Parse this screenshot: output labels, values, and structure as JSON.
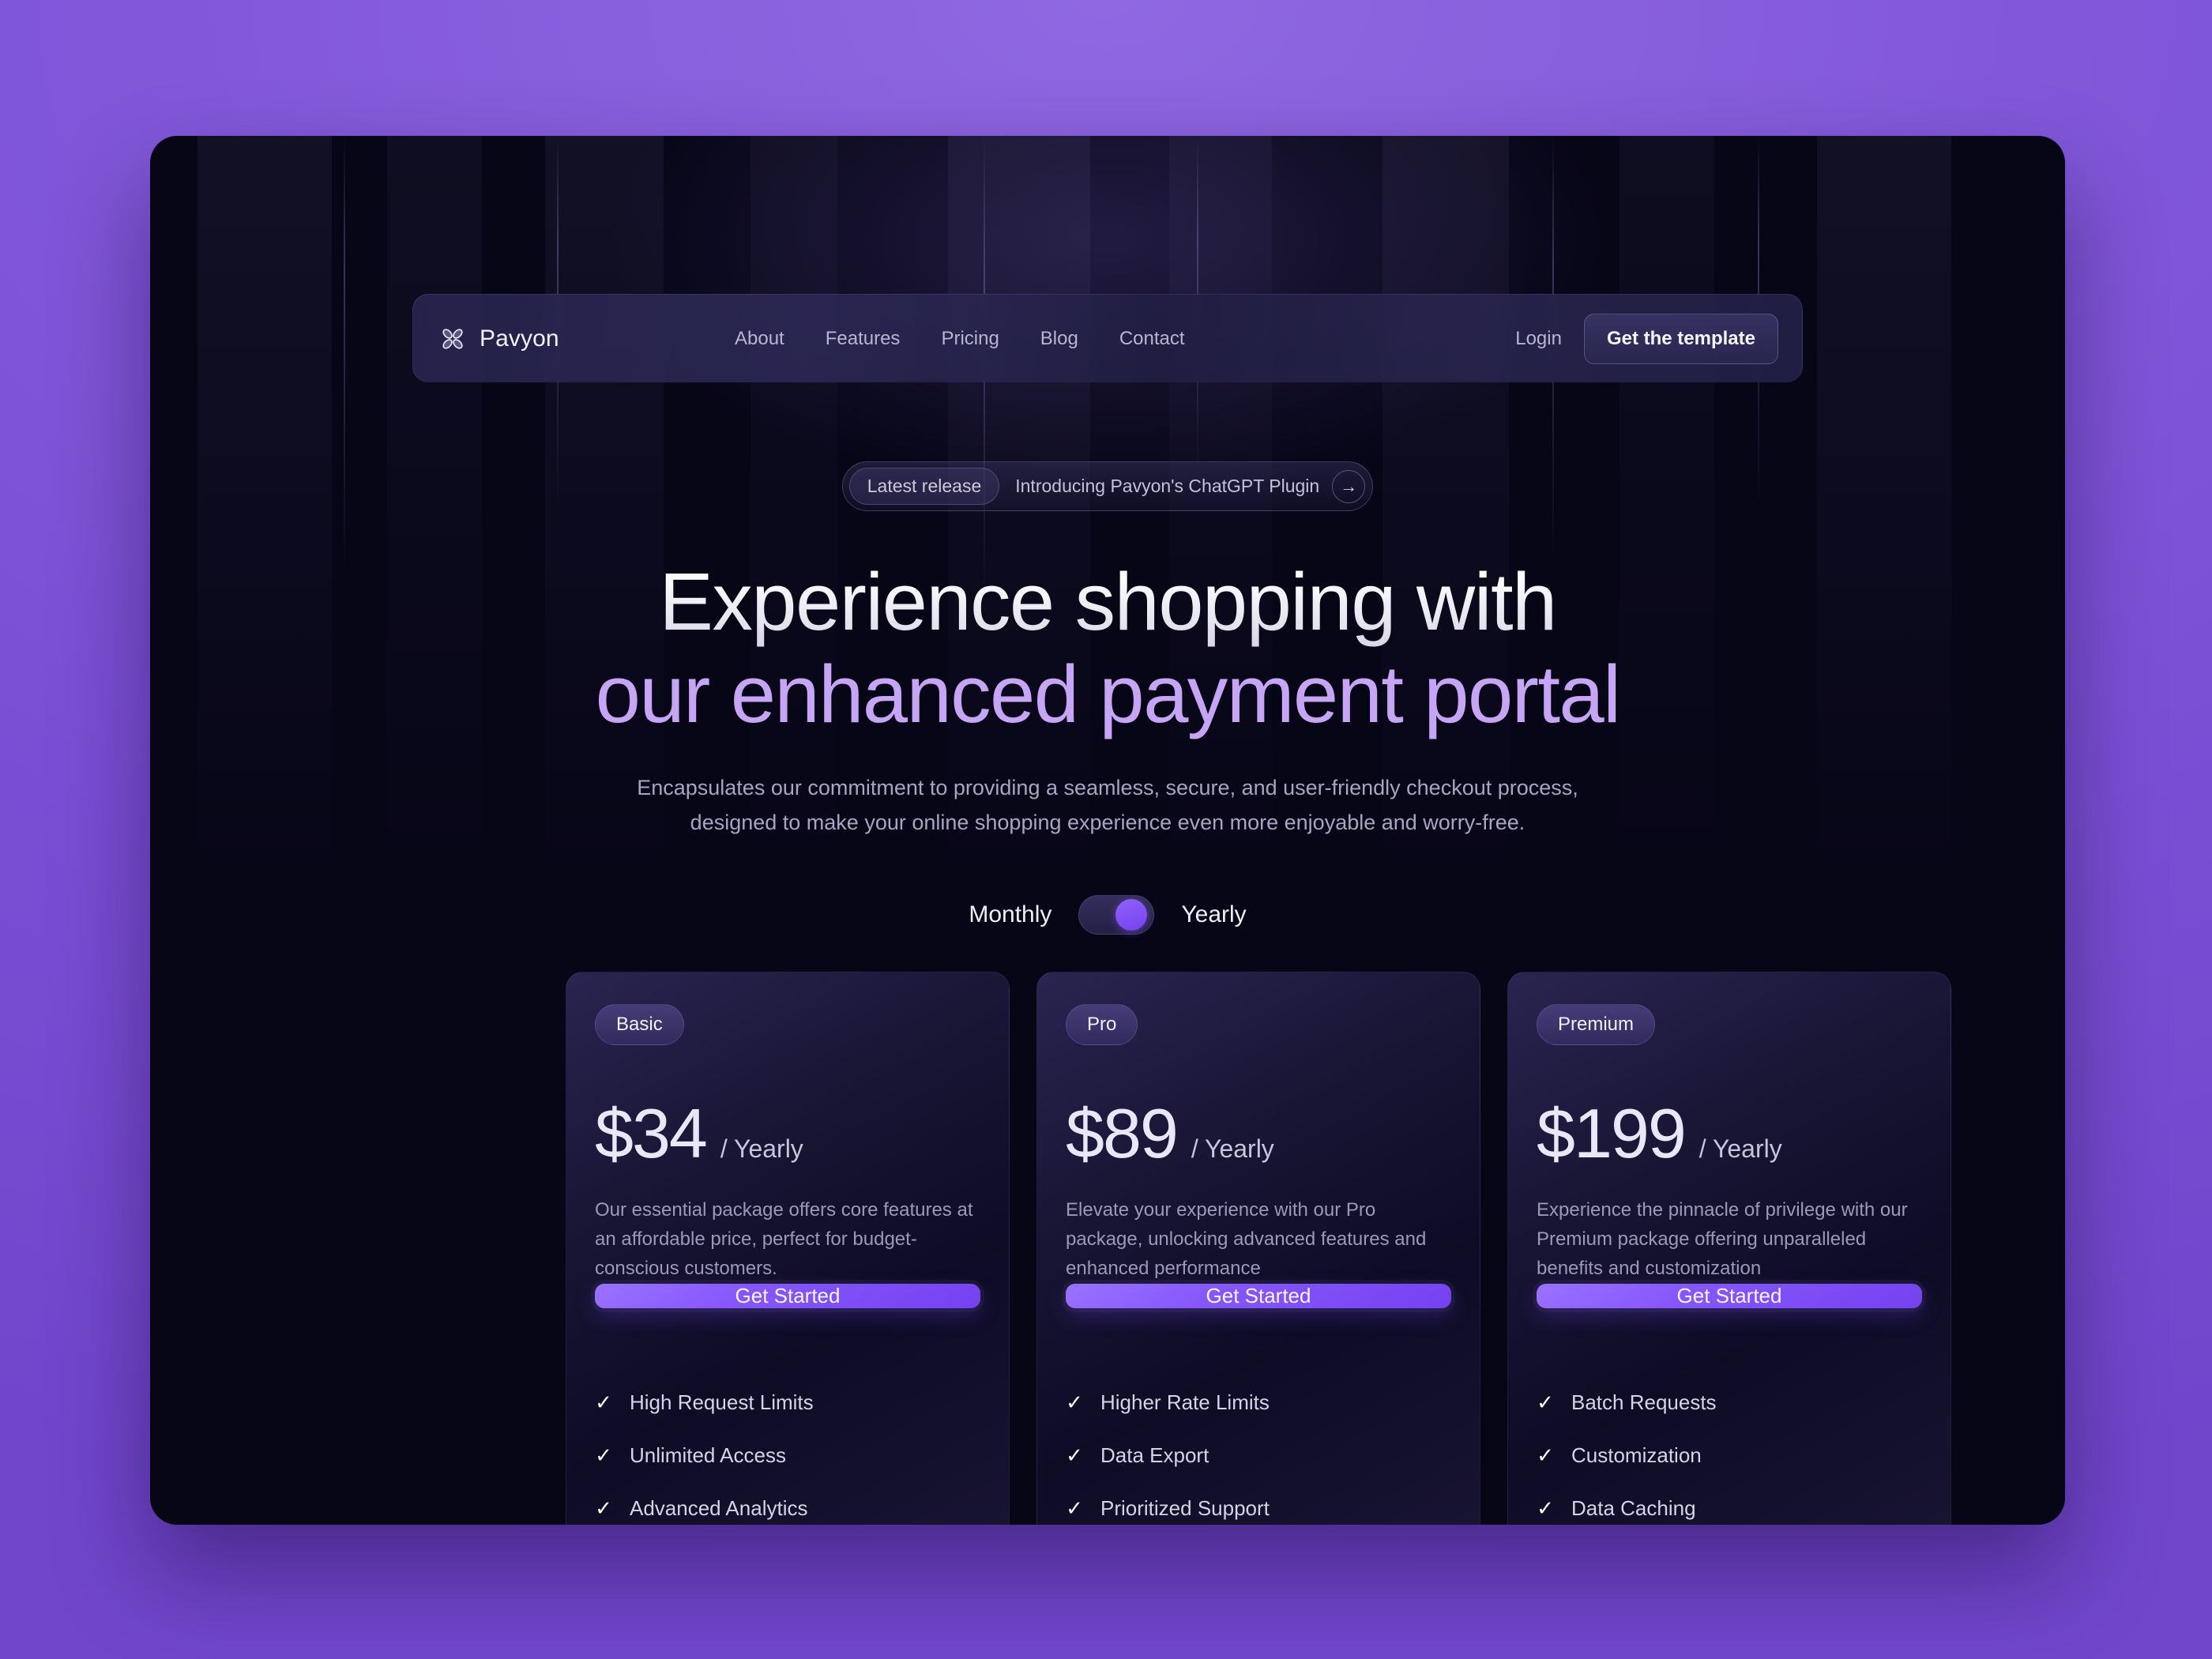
{
  "colors": {
    "page_background_purple": "#7b4fd4",
    "window_background": "#070617",
    "accent_purple": "#7c4ff0",
    "headline_accent": "#c6a5f4"
  },
  "header": {
    "brand": {
      "name": "Pavyon",
      "logo_icon": "clover-logo-icon"
    },
    "nav": [
      {
        "label": "About"
      },
      {
        "label": "Features"
      },
      {
        "label": "Pricing"
      },
      {
        "label": "Blog"
      },
      {
        "label": "Contact"
      }
    ],
    "login_label": "Login",
    "template_button_label": "Get the template"
  },
  "hero": {
    "release_badge": {
      "tag": "Latest release",
      "text": "Introducing Pavyon's ChatGPT Plugin",
      "arrow_icon": "arrow-right-icon"
    },
    "headline_line1": "Experience shopping with",
    "headline_line2": "our enhanced payment portal",
    "subhead_line1": "Encapsulates our commitment to providing a seamless, secure, and user-friendly checkout process,",
    "subhead_line2": "designed to make your online shopping experience even more enjoyable and worry-free."
  },
  "billing_toggle": {
    "left_label": "Monthly",
    "right_label": "Yearly",
    "selected": "Yearly"
  },
  "pricing": {
    "cards": [
      {
        "tier": "Basic",
        "price": "$34",
        "period": "/ Yearly",
        "description": "Our essential package offers core features at an affordable price, perfect for budget-conscious customers.",
        "cta_label": "Get Started",
        "features": [
          {
            "label": "High Request Limits",
            "icon": "check-icon",
            "check": "✓"
          },
          {
            "label": "Unlimited Access",
            "icon": "check-icon",
            "check": "✓"
          },
          {
            "label": "Advanced Analytics",
            "icon": "check-icon",
            "check": "✓"
          }
        ]
      },
      {
        "tier": "Pro",
        "price": "$89",
        "period": "/ Yearly",
        "description": "Elevate your experience with our Pro package, unlocking advanced features and enhanced performance",
        "cta_label": "Get Started",
        "features": [
          {
            "label": "Higher Rate Limits",
            "icon": "check-icon",
            "check": "✓"
          },
          {
            "label": "Data Export",
            "icon": "check-icon",
            "check": "✓"
          },
          {
            "label": "Prioritized Support",
            "icon": "check-icon",
            "check": "✓"
          }
        ]
      },
      {
        "tier": "Premium",
        "price": "$199",
        "period": "/ Yearly",
        "description": "Experience the pinnacle of privilege with our Premium package offering unparalleled benefits and customization",
        "cta_label": "Get Started",
        "features": [
          {
            "label": "Batch Requests",
            "icon": "check-icon",
            "check": "✓"
          },
          {
            "label": "Customization",
            "icon": "check-icon",
            "check": "✓"
          },
          {
            "label": "Data Caching",
            "icon": "check-icon",
            "check": "✓"
          }
        ]
      }
    ]
  }
}
